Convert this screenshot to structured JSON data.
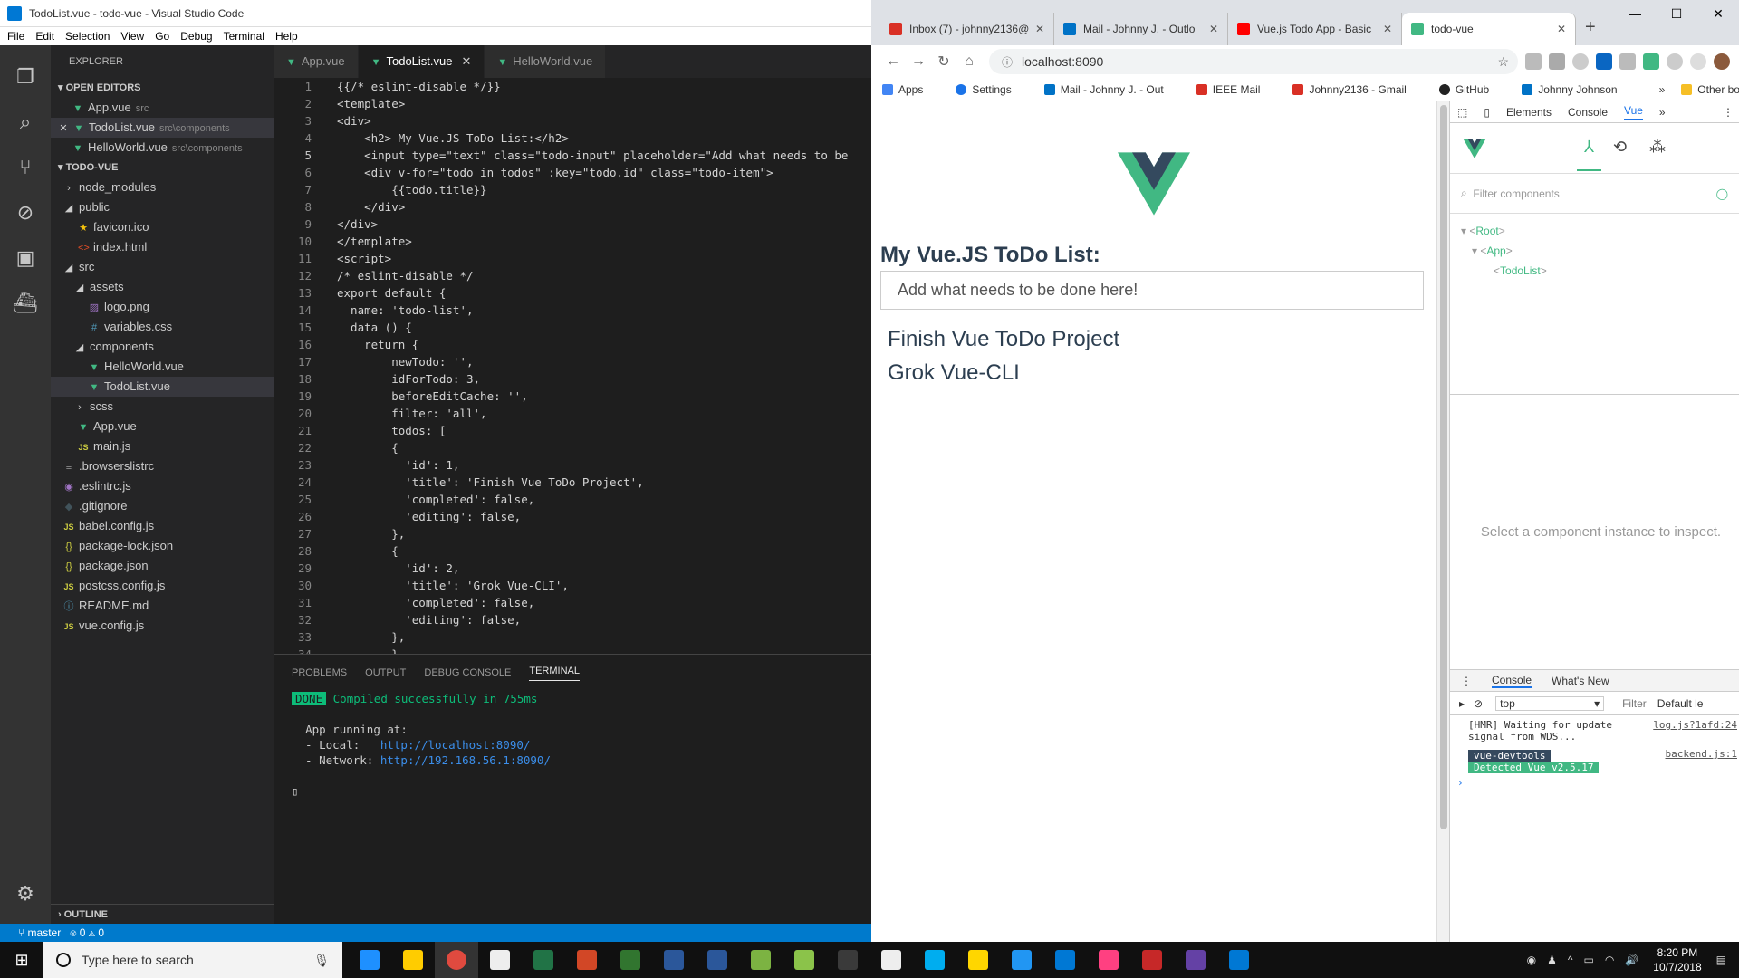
{
  "vscode": {
    "title": "TodoList.vue - todo-vue - Visual Studio Code",
    "menu": [
      "File",
      "Edit",
      "Selection",
      "View",
      "Go",
      "Debug",
      "Terminal",
      "Help"
    ],
    "explorer_title": "EXPLORER",
    "open_editors_title": "OPEN EDITORS",
    "open_editors": [
      {
        "name": "App.vue",
        "path": "src"
      },
      {
        "name": "TodoList.vue",
        "path": "src\\components"
      },
      {
        "name": "HelloWorld.vue",
        "path": "src\\components"
      }
    ],
    "project_title": "TODO-VUE",
    "tree": [
      {
        "label": "node_modules",
        "icon": "chevron-right"
      },
      {
        "label": "public",
        "icon": "chevron-down"
      },
      {
        "label": "favicon.ico",
        "icon": "star"
      },
      {
        "label": "index.html",
        "icon": "html"
      },
      {
        "label": "src",
        "icon": "chevron-down"
      },
      {
        "label": "assets",
        "icon": "chevron-down"
      },
      {
        "label": "logo.png",
        "icon": "image"
      },
      {
        "label": "variables.css",
        "icon": "css"
      },
      {
        "label": "components",
        "icon": "chevron-down"
      },
      {
        "label": "HelloWorld.vue",
        "icon": "vue"
      },
      {
        "label": "TodoList.vue",
        "icon": "vue"
      },
      {
        "label": "scss",
        "icon": "chevron-right"
      },
      {
        "label": "App.vue",
        "icon": "vue"
      },
      {
        "label": "main.js",
        "icon": "js"
      },
      {
        "label": ".browserslistrc",
        "icon": "file"
      },
      {
        "label": ".eslintrc.js",
        "icon": "eslint"
      },
      {
        "label": ".gitignore",
        "icon": "git"
      },
      {
        "label": "babel.config.js",
        "icon": "js"
      },
      {
        "label": "package-lock.json",
        "icon": "json"
      },
      {
        "label": "package.json",
        "icon": "json"
      },
      {
        "label": "postcss.config.js",
        "icon": "js"
      },
      {
        "label": "README.md",
        "icon": "info"
      },
      {
        "label": "vue.config.js",
        "icon": "js"
      }
    ],
    "outline_title": "OUTLINE",
    "tabs": [
      {
        "label": "App.vue"
      },
      {
        "label": "TodoList.vue"
      },
      {
        "label": "HelloWorld.vue"
      }
    ],
    "code_lines": [
      "{{/* eslint-disable */}}",
      "<template>",
      "<div>",
      "    <h2> My Vue.JS ToDo List:</h2>",
      "    <input type=\"text\" class=\"todo-input\" placeholder=\"Add what needs to be",
      "    <div v-for=\"todo in todos\" :key=\"todo.id\" class=\"todo-item\">",
      "        {{todo.title}}",
      "    </div>",
      "</div>",
      "</template>",
      "<script>",
      "/* eslint-disable */",
      "export default {",
      "  name: 'todo-list',",
      "  data () {",
      "    return {",
      "        newTodo: '',",
      "        idForTodo: 3,",
      "        beforeEditCache: '',",
      "        filter: 'all',",
      "        todos: [",
      "        {",
      "          'id': 1,",
      "          'title': 'Finish Vue ToDo Project',",
      "          'completed': false,",
      "          'editing': false,",
      "        },",
      "        {",
      "          'id': 2,",
      "          'title': 'Grok Vue-CLI',",
      "          'completed': false,",
      "          'editing': false,",
      "        },",
      "        }"
    ],
    "panel_tabs": [
      "PROBLEMS",
      "OUTPUT",
      "DEBUG CONSOLE",
      "TERMINAL"
    ],
    "terminal": {
      "done_badge": "DONE",
      "done_msg": "Compiled successfully in 755ms",
      "running": "App running at:",
      "local_label": "  - Local:   ",
      "local_url": "http://localhost:8090/",
      "network_label": "  - Network: ",
      "network_url": "http://192.168.56.1:8090/"
    },
    "status": {
      "branch": "master",
      "problems": "⊗ 0 ⚠ 0"
    }
  },
  "chrome": {
    "tabs": [
      {
        "label": "Inbox (7) - johnny2136@",
        "color": "#d93025"
      },
      {
        "label": "Mail - Johnny J. - Outlo",
        "color": "#0072c6"
      },
      {
        "label": "Vue.js Todo App - Basic",
        "color": "#ff0000"
      },
      {
        "label": "todo-vue",
        "color": "#41b883"
      }
    ],
    "url": "localhost:8090",
    "bookmarks": [
      "Apps",
      "Settings",
      "Mail - Johnny J. - Out",
      "IEEE Mail",
      "Johnny2136 - Gmail",
      "GitHub",
      "Johnny Johnson"
    ],
    "other_bookmarks": "Other bookmarks",
    "page": {
      "heading": "My Vue.JS ToDo List:",
      "input_placeholder": "Add what needs to be done here!",
      "todos": [
        "Finish Vue ToDo Project",
        "Grok Vue-CLI"
      ]
    },
    "devtools": {
      "tabs": [
        "Elements",
        "Console",
        "Vue"
      ],
      "filter_placeholder": "Filter components",
      "tree": [
        "Root",
        "App",
        "TodoList"
      ],
      "inspect_msg": "Select a component instance to inspect.",
      "console_tabs": [
        "Console",
        "What's New"
      ],
      "context": "top",
      "filter_label": "Filter",
      "levels_label": "Default le",
      "log1": "[HMR] Waiting for update signal from WDS...",
      "log1_src": "log.js?1afd:24",
      "badge_a": "vue-devtools",
      "badge_b": "Detected Vue v2.5.17",
      "log2_src": "backend.js:1"
    }
  },
  "taskbar": {
    "search_placeholder": "Type here to search",
    "time": "8:20 PM",
    "date": "10/7/2018",
    "apps": [
      "#1e90ff",
      "#ffcc00",
      "#e04a3f",
      "#eee",
      "#217346",
      "#d24726",
      "#31752f",
      "#2b579a",
      "#2b579a",
      "#7cb342",
      "#8bc34a",
      "#3a3a3a",
      "#eee",
      "#00adef",
      "#ffd600",
      "#2196f3",
      "#0078d4",
      "#ff4081",
      "#c62828",
      "#6441a5",
      "#0078d4"
    ]
  }
}
